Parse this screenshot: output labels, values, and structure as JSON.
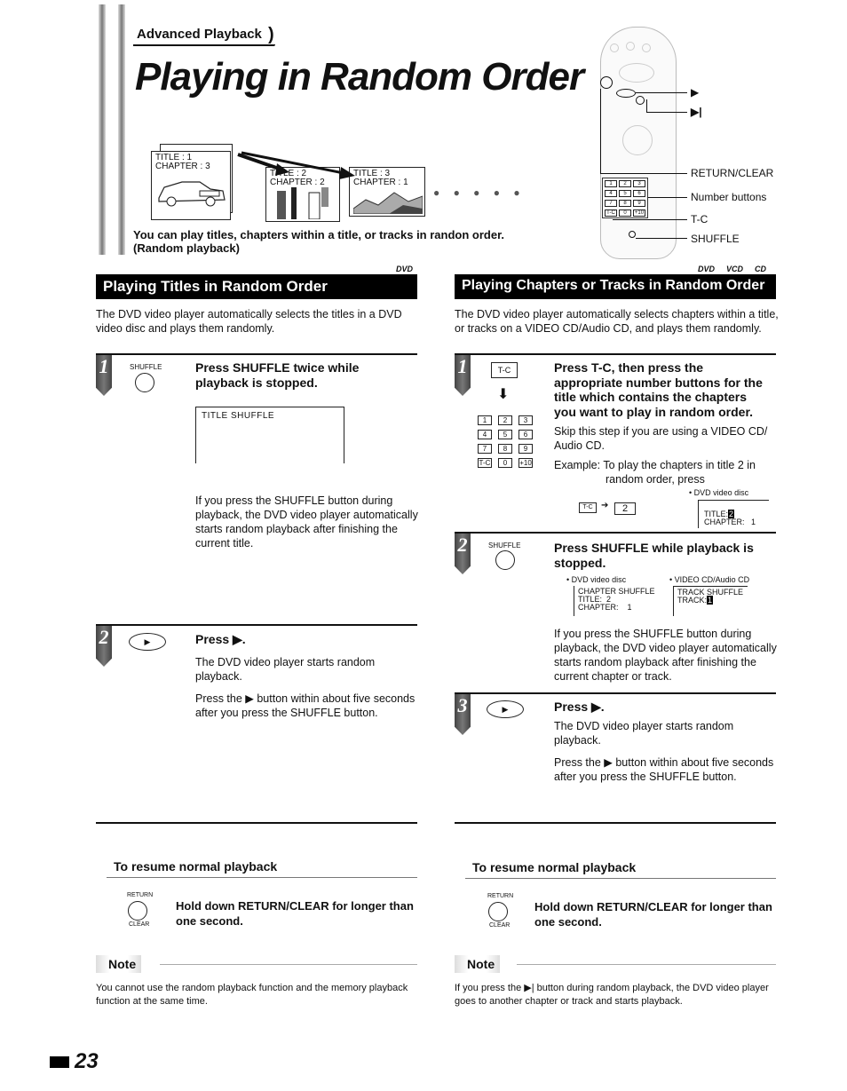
{
  "breadcrumb": "Advanced Playback",
  "page_title": "Playing in Random Order",
  "hero": {
    "frames": [
      {
        "title": "TITLE : 1",
        "chapter": "CHAPTER : 3"
      },
      {
        "title": "TITLE : 2",
        "chapter": "CHAPTER : 2"
      },
      {
        "title": "TITLE : 3",
        "chapter": "CHAPTER : 1"
      }
    ],
    "ellipsis": "● ● ● ● ●",
    "intro_line1": "You can play titles, chapters within a title, or tracks in randon order.",
    "intro_line2": "(Random playback)"
  },
  "remote": {
    "callouts": {
      "play": "▶",
      "skip": "▶|",
      "return_clear": "RETURN/CLEAR",
      "number_buttons": "Number buttons",
      "tc": "T-C",
      "shuffle": "SHUFFLE"
    },
    "keys": [
      "1",
      "2",
      "3",
      "4",
      "5",
      "6",
      "7",
      "8",
      "9",
      "T-C",
      "0",
      "+10"
    ]
  },
  "left_section": {
    "header": "Playing Titles in Random Order",
    "disc_tags": [
      "DVD"
    ],
    "description": "The DVD video player automatically selects the titles in a DVD video disc and plays them randomly.",
    "step1": {
      "number": "1",
      "button_label": "SHUFFLE",
      "heading_line1": "Press SHUFFLE twice while",
      "heading_line2": "playback is stopped.",
      "osd": "TITLE SHUFFLE",
      "body": "If you press the SHUFFLE button during playback, the DVD video player automatically starts random playback after finishing the current title."
    },
    "step2": {
      "number": "2",
      "heading": "Press ▶.",
      "body1": "The DVD video player starts random playback.",
      "body2": "Press the ▶ button within about five seconds after you press the SHUFFLE button."
    },
    "resume": {
      "heading": "To resume normal playback",
      "button_top": "RETURN",
      "button_bottom": "CLEAR",
      "instruction_line1": "Hold down RETURN/CLEAR for longer than",
      "instruction_line2": "one second."
    },
    "note": {
      "label": "Note",
      "text": "You cannot use the random playback function and the memory playback function at the same time."
    }
  },
  "right_section": {
    "header": "Playing Chapters or Tracks in Random Order",
    "disc_tags": [
      "DVD",
      "VCD",
      "CD"
    ],
    "description": "The DVD video player automatically selects chapters within a title, or tracks on a VIDEO CD/Audio CD, and plays them randomly.",
    "step1": {
      "number": "1",
      "tc_label": "T-C",
      "keys": [
        "1",
        "2",
        "3",
        "4",
        "5",
        "6",
        "7",
        "8",
        "9",
        "T-C",
        "0",
        "+10"
      ],
      "heading": [
        "Press T-C, then press the",
        "appropriate number buttons for the",
        "title which contains the chapters",
        "you want to play in random order."
      ],
      "skip_note": "Skip this step if you are using a VIDEO CD/ Audio CD.",
      "example_line1": "Example: To play the chapters in title 2 in",
      "example_line2": "random order, press",
      "example_keys": [
        "T-C",
        "2"
      ],
      "osd_caption": "• DVD video disc",
      "osd_title": "TITLE:",
      "osd_title_value": "2",
      "osd_chapter": "CHAPTER:   1"
    },
    "step2": {
      "number": "2",
      "button_label": "SHUFFLE",
      "heading_line1": "Press SHUFFLE while playback is",
      "heading_line2": "stopped.",
      "osd_dvd_caption": "• DVD video disc",
      "osd_dvd_lines": [
        "CHAPTER SHUFFLE",
        "TITLE:  2",
        "CHAPTER:    1"
      ],
      "osd_vcd_caption": "• VIDEO CD/Audio CD",
      "osd_vcd_line1": "TRACK SHUFFLE",
      "osd_vcd_track_label": "TRACK:",
      "osd_vcd_track_value": "1",
      "body": "If you press the SHUFFLE button during playback, the DVD video player automatically starts random playback after finishing the current chapter or track."
    },
    "step3": {
      "number": "3",
      "heading": "Press ▶.",
      "body1": "The DVD video player starts random playback.",
      "body2": "Press the ▶ button within about five seconds after you press the SHUFFLE button."
    },
    "resume": {
      "heading": "To resume normal playback",
      "button_top": "RETURN",
      "button_bottom": "CLEAR",
      "instruction_line1": "Hold down RETURN/CLEAR for longer than",
      "instruction_line2": "one second."
    },
    "note": {
      "label": "Note",
      "text": "If you press the ▶| button during random playback, the DVD video player goes to another chapter or track and starts playback."
    }
  },
  "page_number": "23"
}
